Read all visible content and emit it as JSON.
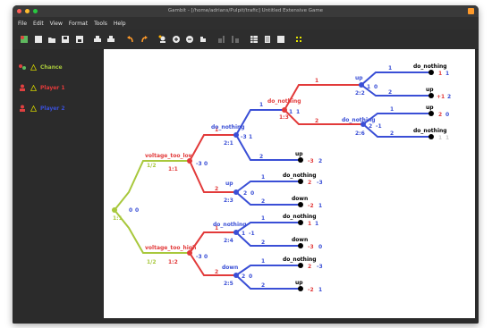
{
  "window": {
    "title": "Gambit - [/home/adrians/Pulpit/trafic] Untitled Extensive Game"
  },
  "menu": [
    "File",
    "Edit",
    "View",
    "Format",
    "Tools",
    "Help"
  ],
  "toolbar": {
    "icons": [
      "new-icon",
      "save-icon",
      "open-icon",
      "save-as-icon",
      "export-icon",
      "print-icon",
      "print-preview-icon",
      "undo-icon",
      "redo-icon",
      "add-player-icon",
      "zoom-in-icon",
      "zoom-out-icon",
      "zoom-fit-icon",
      "decrease-spacing-icon",
      "increase-spacing-icon",
      "table-icon",
      "document-icon",
      "profiles-icon"
    ]
  },
  "players": [
    {
      "label": "Chance",
      "color": "#a8c83c"
    },
    {
      "label": "Player 1",
      "color": "#e23a3a"
    },
    {
      "label": "Player 2",
      "color": "#3a4fd6"
    }
  ],
  "tree": {
    "root": {
      "label": "1:1",
      "payoff_a": "0",
      "payoff_b": "0"
    },
    "chance_prob_top": "1/2",
    "chance_prob_bottom": "1/2",
    "n1": {
      "action_label": "voltage_too_low",
      "id": "1:1",
      "payoff_a": "-3",
      "payoff_b": "0"
    },
    "n2": {
      "action_label": "voltage_too_high",
      "id": "1:2",
      "payoff_a": "-3",
      "payoff_b": "0"
    },
    "n3": {
      "action_label": "do_nothing",
      "id": "2:1",
      "payoff_a": "-3",
      "payoff_b": "1"
    },
    "n4": {
      "action_label": "up",
      "id": "2:3",
      "payoff_a": "2",
      "payoff_b": "0"
    },
    "n5": {
      "action_label": "do_nothing",
      "id": "1:3",
      "payoff_a": "1",
      "payoff_b": "1"
    },
    "n6": {
      "action_label": "up",
      "id": "2:2",
      "payoff_a": "1",
      "payoff_b": "0"
    },
    "n7": {
      "action_label": "do_nothing",
      "id": "2:6",
      "payoff_a": "2",
      "payoff_b": "-1"
    },
    "n8": {
      "action_label": "do_nothing",
      "id": "2:4",
      "payoff_a": "1",
      "payoff_b": "-1"
    },
    "n9": {
      "action_label": "down",
      "id": "2:5",
      "payoff_a": "2",
      "payoff_b": "0"
    },
    "branch_1": "1",
    "branch_2": "2",
    "t1": {
      "label": "do_nothing",
      "a": "1",
      "b": "1"
    },
    "t2": {
      "label": "up",
      "a": "+1",
      "b": "2"
    },
    "t3": {
      "label": "up",
      "a": "2",
      "b": "0"
    },
    "t4": {
      "label": "do_nothing",
      "a": "1",
      "b": "1"
    },
    "t5": {
      "label": "up",
      "a": "-3",
      "b": "2"
    },
    "t6": {
      "label": "do_nothing",
      "a": "2",
      "b": "-3"
    },
    "t7": {
      "label": "down",
      "a": "-2",
      "b": "1"
    },
    "t8": {
      "label": "do_nothing",
      "a": "1",
      "b": "1"
    },
    "t9": {
      "label": "down",
      "a": "-3",
      "b": "0"
    },
    "t10": {
      "label": "do_nothing",
      "a": "2",
      "b": "-3"
    },
    "t11": {
      "label": "up",
      "a": "-2",
      "b": "1"
    }
  }
}
